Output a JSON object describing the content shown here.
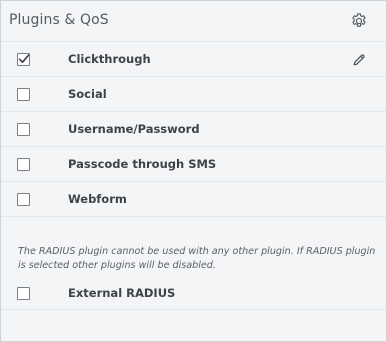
{
  "header": {
    "title": "Plugins & QoS",
    "settings_icon": "gear-icon"
  },
  "plugins": [
    {
      "label": "Clickthrough",
      "checked": true,
      "editable": true
    },
    {
      "label": "Social",
      "checked": false,
      "editable": false
    },
    {
      "label": "Username/Password",
      "checked": false,
      "editable": false
    },
    {
      "label": "Passcode through SMS",
      "checked": false,
      "editable": false
    },
    {
      "label": "Webform",
      "checked": false,
      "editable": false
    }
  ],
  "radius": {
    "note": "The RADIUS plugin cannot be used with any other plugin. If RADIUS plugin is selected other plugins will be disabled.",
    "label": "External RADIUS",
    "checked": false
  },
  "icons": {
    "edit": "pencil-icon",
    "check": "checkmark-icon"
  }
}
